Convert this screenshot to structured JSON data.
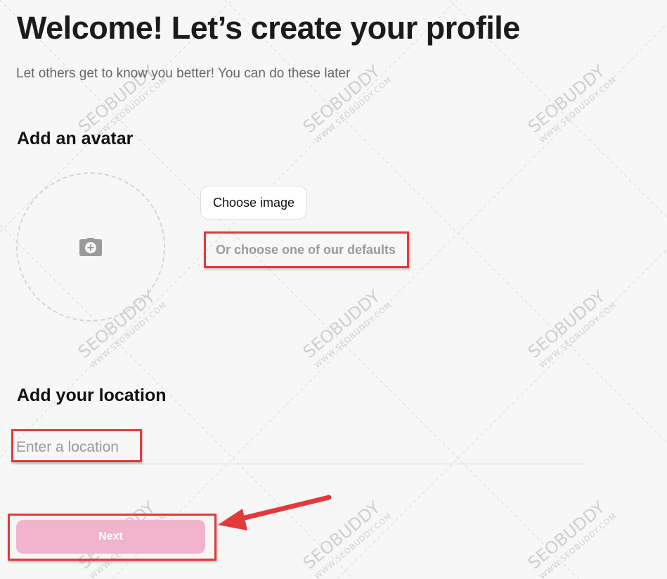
{
  "page": {
    "title": "Welcome! Let’s create your profile",
    "subtitle": "Let others get to know you better! You can do these later"
  },
  "avatar_section": {
    "heading": "Add an avatar",
    "placeholder_icon": "camera-plus-icon",
    "choose_image_label": "Choose image",
    "defaults_link_label": "Or choose one of our defaults"
  },
  "location_section": {
    "heading": "Add your location",
    "input_value": "",
    "input_placeholder": "Enter a location"
  },
  "next_button": {
    "label": "Next",
    "color": "#f2b4cb"
  },
  "annotations": {
    "highlight_color": "#e23a3a",
    "arrow_target": "next-button"
  },
  "watermark": {
    "brand": "SEOBUDDY",
    "url": "WWW.SEOBUDDY.COM"
  }
}
